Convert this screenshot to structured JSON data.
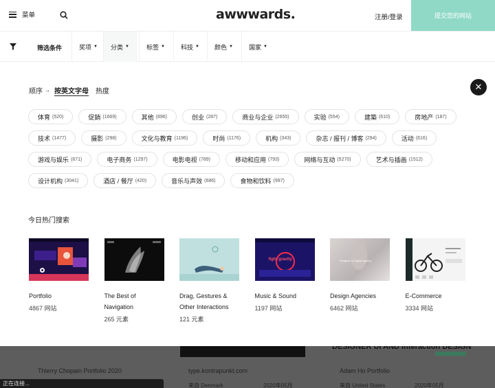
{
  "header": {
    "menu_label": "菜单",
    "logo": "awwwards.",
    "login": "注册/登录",
    "submit": "提交您的网站"
  },
  "filterbar": {
    "title": "筛选条件",
    "tabs": [
      {
        "label": "奖项"
      },
      {
        "label": "分类"
      },
      {
        "label": "标签"
      },
      {
        "label": "科技"
      },
      {
        "label": "颜色"
      },
      {
        "label": "国家"
      }
    ],
    "active_tab": "分类"
  },
  "sort": {
    "label": "顺序",
    "options": [
      "按英文字母",
      "热度"
    ],
    "active": "按英文字母"
  },
  "tags": [
    [
      {
        "name": "体育",
        "count": "(520)"
      },
      {
        "name": "促銷",
        "count": "(1669)"
      },
      {
        "name": "其他",
        "count": "(896)"
      },
      {
        "name": "创业",
        "count": "(287)"
      },
      {
        "name": "商业与企业",
        "count": "(2655)"
      },
      {
        "name": "实验",
        "count": "(554)"
      },
      {
        "name": "建築",
        "count": "(610)"
      },
      {
        "name": "房地产",
        "count": "(187)"
      }
    ],
    [
      {
        "name": "技术",
        "count": "(1477)"
      },
      {
        "name": "摄影",
        "count": "(298)"
      },
      {
        "name": "文化与教育",
        "count": "(1196)"
      },
      {
        "name": "时尚",
        "count": "(1176)"
      },
      {
        "name": "机构",
        "count": "(343)"
      },
      {
        "name": "杂志 / 报刊 / 博客",
        "count": "(294)"
      },
      {
        "name": "活动",
        "count": "(616)"
      }
    ],
    [
      {
        "name": "游戏与娱乐",
        "count": "(671)"
      },
      {
        "name": "电子商务",
        "count": "(1297)"
      },
      {
        "name": "电影电视",
        "count": "(789)"
      },
      {
        "name": "移动和应用",
        "count": "(793)"
      },
      {
        "name": "网络与互动",
        "count": "(5270)"
      },
      {
        "name": "艺术与插画",
        "count": "(1512)"
      }
    ],
    [
      {
        "name": "设计机构",
        "count": "(3041)"
      },
      {
        "name": "酒店 / 餐厅",
        "count": "(420)"
      },
      {
        "name": "音乐与声效",
        "count": "(686)"
      },
      {
        "name": "食物和饮料",
        "count": "(997)"
      }
    ]
  ],
  "hot": {
    "title": "今日热门搜索",
    "cards": [
      {
        "name": "Portfolio",
        "count": "4867 网站"
      },
      {
        "name": "The Best of Navigation",
        "count": "265 元素"
      },
      {
        "name": "Drag, Gestures & Other Interactions",
        "count": "121 元素"
      },
      {
        "name": "Music & Sound",
        "count": "1197 网站"
      },
      {
        "name": "Design Agencies",
        "count": "6462 网站"
      },
      {
        "name": "E-Commerce",
        "count": "3334 网站"
      }
    ]
  },
  "thumb_texts": {
    "music": "fight gravity",
    "agencies": "Designer & Digital Agency"
  },
  "background": {
    "item1": "Thierry Chopain Portfolio 2020",
    "item2": "type.kontrapunkt.com",
    "item3": "Adam Ho Portfolio",
    "item4": "DESIGNER UI AND Interaction DESIGN",
    "date1": "2020年05月",
    "date2": "2020年05月",
    "loc1": "来自 Denmark",
    "loc2": "来自 United States"
  },
  "status": "正在连接..."
}
